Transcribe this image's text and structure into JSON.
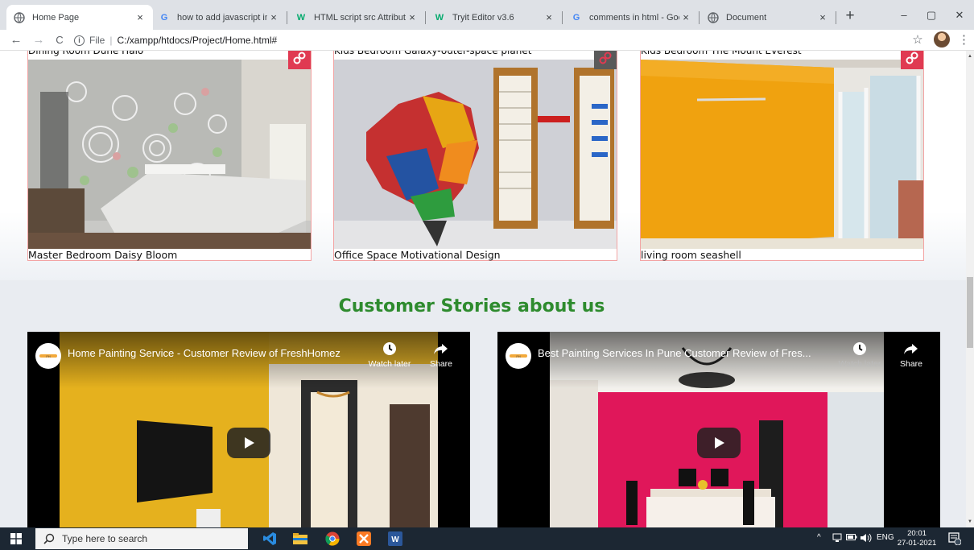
{
  "browser": {
    "tabs": [
      {
        "title": "Home Page",
        "icon": "globe-icon",
        "active": true
      },
      {
        "title": "how to add javascript in html",
        "icon": "google-icon"
      },
      {
        "title": "HTML script src Attribute",
        "icon": "w3schools-icon"
      },
      {
        "title": "Tryit Editor v3.6",
        "icon": "w3schools-icon"
      },
      {
        "title": "comments in html - Google Se",
        "icon": "google-icon"
      },
      {
        "title": "Document",
        "icon": "globe-icon"
      }
    ],
    "close_glyph": "×",
    "new_tab_glyph": "+",
    "window_controls": {
      "minimize": "–",
      "maximize": "▢",
      "close": "✕"
    },
    "nav": {
      "back": "←",
      "forward": "→",
      "reload": "C"
    },
    "address": {
      "scheme_label": "File",
      "separator": "|",
      "url": "C:/xampp/htdocs/Project/Home.html#"
    },
    "bookmark_glyph": "☆",
    "menu_glyph": "⋮"
  },
  "gallery": {
    "cards": [
      {
        "top_caption": "Dining Room Dune Halo",
        "bottom_caption": "Master Bedroom Daisy Bloom",
        "badge": "link-icon"
      },
      {
        "top_caption": "Kids Bedroom Galaxy-outer-space planet",
        "bottom_caption": "Office Space Motivational Design",
        "badge": "link-icon"
      },
      {
        "top_caption": "Kids Bedroom The Mount Everest",
        "bottom_caption": "living room seashell",
        "badge": "link-icon"
      }
    ]
  },
  "stories": {
    "title": "Customer Stories about us",
    "videos": [
      {
        "title": "Home Painting Service - Customer Review of FreshHomez",
        "watch_later": "Watch later",
        "share": "Share"
      },
      {
        "title": "Best Painting Services In Pune Customer Review of Fres...",
        "watch_later": "Watch later",
        "share": "Share"
      }
    ]
  },
  "taskbar": {
    "search_placeholder": "Type here to search",
    "tray_chevron": "^",
    "language": "ENG",
    "time": "20:01",
    "date": "27-01-2021",
    "notification_count": "1"
  },
  "colors": {
    "accent_green": "#2e8b2e",
    "badge_red": "#e03a52",
    "card_border": "#f3a4a4"
  }
}
